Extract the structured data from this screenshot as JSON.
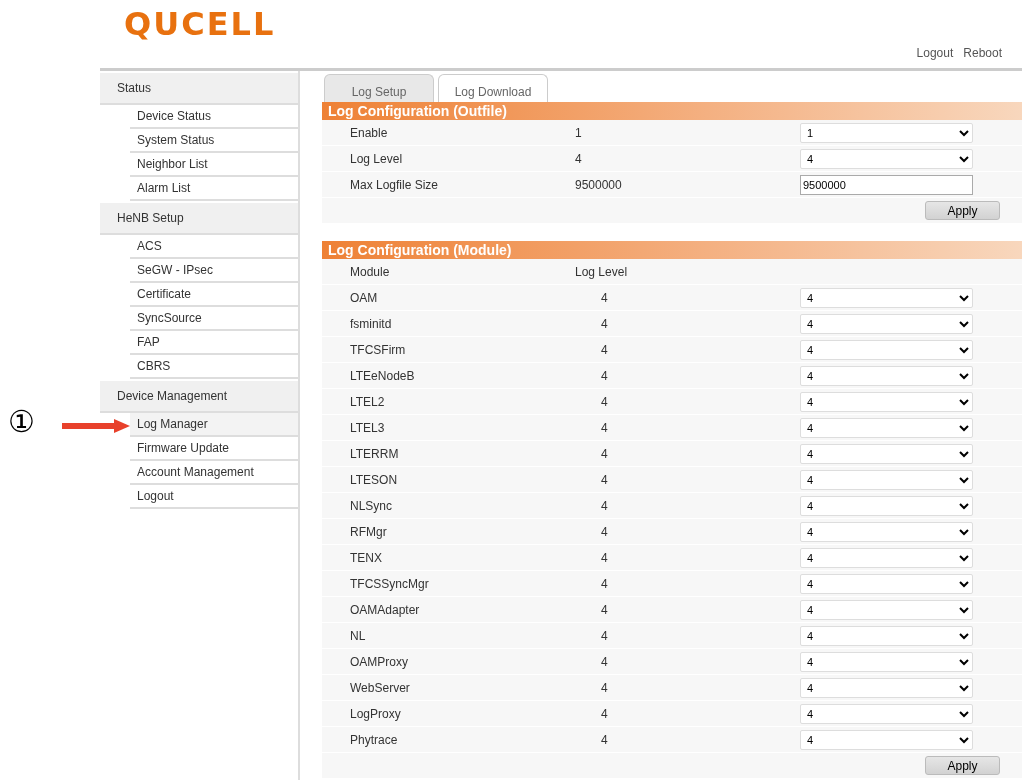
{
  "logo": "QUCELL",
  "header_links": [
    "Logout",
    "Reboot"
  ],
  "sidebar": [
    {
      "label": "Status",
      "children": [
        {
          "label": "Device Status",
          "selected": false
        },
        {
          "label": "System Status",
          "selected": false
        },
        {
          "label": "Neighbor List",
          "selected": false
        },
        {
          "label": "Alarm List",
          "selected": false
        }
      ]
    },
    {
      "label": "HeNB Setup",
      "children": [
        {
          "label": "ACS",
          "selected": false
        },
        {
          "label": "SeGW - IPsec",
          "selected": false
        },
        {
          "label": "Certificate",
          "selected": false
        },
        {
          "label": "SyncSource",
          "selected": false
        },
        {
          "label": "FAP",
          "selected": false
        },
        {
          "label": "CBRS",
          "selected": false
        }
      ]
    },
    {
      "label": "Device Management",
      "children": [
        {
          "label": "Log Manager",
          "selected": true
        },
        {
          "label": "Firmware Update",
          "selected": false
        },
        {
          "label": "Account Management",
          "selected": false
        },
        {
          "label": "Logout",
          "selected": false
        }
      ]
    }
  ],
  "annotation": {
    "label": "①"
  },
  "tabs": [
    {
      "label": "Log Setup",
      "selected": false
    },
    {
      "label": "Log Download",
      "selected": true
    }
  ],
  "outfile": {
    "title": "Log Configuration (Outfile)",
    "rows": [
      {
        "kind": "select",
        "label": "Enable",
        "value": "1",
        "control": "1"
      },
      {
        "kind": "select",
        "label": "Log Level",
        "value": "4",
        "control": "4"
      },
      {
        "kind": "input",
        "label": "Max Logfile Size",
        "value": "9500000",
        "control": "9500000"
      }
    ],
    "button": "Apply"
  },
  "module": {
    "title": "Log Configuration (Module)",
    "columns": [
      "Module",
      "Log Level"
    ],
    "rows": [
      {
        "module": "OAM",
        "level": "4",
        "control": "4"
      },
      {
        "module": "fsminitd",
        "level": "4",
        "control": "4"
      },
      {
        "module": "TFCSFirm",
        "level": "4",
        "control": "4"
      },
      {
        "module": "LTEeNodeB",
        "level": "4",
        "control": "4"
      },
      {
        "module": "LTEL2",
        "level": "4",
        "control": "4"
      },
      {
        "module": "LTEL3",
        "level": "4",
        "control": "4"
      },
      {
        "module": "LTERRM",
        "level": "4",
        "control": "4"
      },
      {
        "module": "LTESON",
        "level": "4",
        "control": "4"
      },
      {
        "module": "NLSync",
        "level": "4",
        "control": "4"
      },
      {
        "module": "RFMgr",
        "level": "4",
        "control": "4"
      },
      {
        "module": "TENX",
        "level": "4",
        "control": "4"
      },
      {
        "module": "TFCSSyncMgr",
        "level": "4",
        "control": "4"
      },
      {
        "module": "OAMAdapter",
        "level": "4",
        "control": "4"
      },
      {
        "module": "NL",
        "level": "4",
        "control": "4"
      },
      {
        "module": "OAMProxy",
        "level": "4",
        "control": "4"
      },
      {
        "module": "WebServer",
        "level": "4",
        "control": "4"
      },
      {
        "module": "LogProxy",
        "level": "4",
        "control": "4"
      },
      {
        "module": "Phytrace",
        "level": "4",
        "control": "4"
      }
    ],
    "button": "Apply"
  }
}
